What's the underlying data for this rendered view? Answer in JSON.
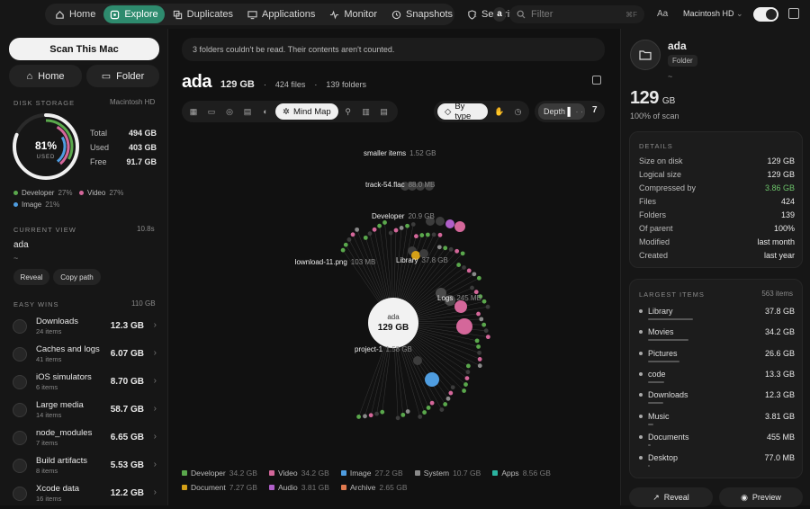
{
  "topbar": {
    "nav": [
      {
        "label": "Home",
        "icon": "home-icon"
      },
      {
        "label": "Explore",
        "icon": "compass-icon",
        "active": true
      },
      {
        "label": "Duplicates",
        "icon": "copy-icon"
      },
      {
        "label": "Applications",
        "icon": "monitor-icon"
      },
      {
        "label": "Monitor",
        "icon": "activity-icon"
      },
      {
        "label": "Snapshots",
        "icon": "clock-icon"
      },
      {
        "label": "Security",
        "icon": "shield-icon"
      }
    ],
    "avatar": "a",
    "filter_placeholder": "Filter",
    "filter_kbd": "⌘F",
    "text_size": "Aa",
    "volume": "Macintosh HD"
  },
  "sidebar": {
    "scan_label": "Scan This Mac",
    "home_label": "Home",
    "folder_label": "Folder",
    "disk_title": "DISK STORAGE",
    "disk_volume": "Macintosh HD",
    "used_pct": "81%",
    "used_word": "USED",
    "used_fraction": 0.81,
    "stats": [
      {
        "label": "Total",
        "value": "494 GB"
      },
      {
        "label": "Used",
        "value": "403 GB"
      },
      {
        "label": "Free",
        "value": "91.7 GB"
      }
    ],
    "legend": [
      {
        "label": "Developer",
        "pct": "27%",
        "color": "#5aa84c"
      },
      {
        "label": "Video",
        "pct": "27%",
        "color": "#d4679a"
      },
      {
        "label": "Image",
        "pct": "21%",
        "color": "#4f9de0"
      }
    ],
    "current_title": "CURRENT VIEW",
    "current_time": "10.8s",
    "current_name": "ada",
    "current_path": "~",
    "reveal_label": "Reveal",
    "copy_label": "Copy path",
    "wins_title": "EASY WINS",
    "wins_total": "110 GB",
    "wins": [
      {
        "title": "Downloads",
        "sub": "24 items",
        "size": "12.3 GB"
      },
      {
        "title": "Caches and logs",
        "sub": "41 items",
        "size": "6.07 GB"
      },
      {
        "title": "iOS simulators",
        "sub": "6 items",
        "size": "8.70 GB"
      },
      {
        "title": "Large media",
        "sub": "14 items",
        "size": "58.7 GB"
      },
      {
        "title": "node_modules",
        "sub": "7 items",
        "size": "6.65 GB"
      },
      {
        "title": "Build artifacts",
        "sub": "8 items",
        "size": "5.53 GB"
      },
      {
        "title": "Xcode data",
        "sub": "16 items",
        "size": "12.2 GB"
      }
    ]
  },
  "main": {
    "banner": "3 folders couldn't be read. Their contents aren't counted.",
    "name": "ada",
    "size": "129 GB",
    "files": "424 files",
    "folders": "139 folders",
    "sep": "·",
    "view_active": "Mind Map",
    "type_active": "By type",
    "depth_label": "Depth",
    "depth_value": "7",
    "center_name": "ada",
    "center_size": "129 GB",
    "map_labels": [
      {
        "name": "smaller items",
        "size": "1.52 GB"
      },
      {
        "name": "track-54.flac",
        "size": "88.0 MB"
      },
      {
        "name": "Developer",
        "size": "20.9 GB"
      },
      {
        "name": "download-11.png",
        "size": "103 MB"
      },
      {
        "name": "Library",
        "size": "37.8 GB"
      },
      {
        "name": "Logs",
        "size": "245 MB"
      },
      {
        "name": "project-1",
        "size": "1.58 GB"
      }
    ],
    "legend": [
      {
        "label": "Developer",
        "size": "34.2 GB",
        "color": "#5aa84c"
      },
      {
        "label": "Video",
        "size": "34.2 GB",
        "color": "#d4679a"
      },
      {
        "label": "Image",
        "size": "27.2 GB",
        "color": "#4f9de0"
      },
      {
        "label": "System",
        "size": "10.7 GB",
        "color": "#8a8a8a"
      },
      {
        "label": "Apps",
        "size": "8.56 GB",
        "color": "#2bb3a0"
      },
      {
        "label": "Document",
        "size": "7.27 GB",
        "color": "#d4a017"
      },
      {
        "label": "Audio",
        "size": "3.81 GB",
        "color": "#b05fc9"
      },
      {
        "label": "Archive",
        "size": "2.65 GB",
        "color": "#e07a4f"
      }
    ]
  },
  "details": {
    "name": "ada",
    "kind": "Folder",
    "path": "~",
    "size": "129",
    "unit": "GB",
    "pct_scan": "100% of scan",
    "title": "DETAILS",
    "rows": [
      {
        "k": "Size on disk",
        "v": "129 GB"
      },
      {
        "k": "Logical size",
        "v": "129 GB"
      },
      {
        "k": "Compressed by",
        "v": "3.86 GB",
        "green": true
      },
      {
        "k": "Files",
        "v": "424"
      },
      {
        "k": "Folders",
        "v": "139"
      },
      {
        "k": "Of parent",
        "v": "100%"
      },
      {
        "k": "Modified",
        "v": "last month"
      },
      {
        "k": "Created",
        "v": "last year"
      }
    ],
    "largest_title": "LARGEST ITEMS",
    "largest_count": "563 items",
    "largest": [
      {
        "n": "Library",
        "v": "37.8 GB",
        "f": 1.0
      },
      {
        "n": "Movies",
        "v": "34.2 GB",
        "f": 0.9
      },
      {
        "n": "Pictures",
        "v": "26.6 GB",
        "f": 0.7
      },
      {
        "n": "code",
        "v": "13.3 GB",
        "f": 0.35
      },
      {
        "n": "Downloads",
        "v": "12.3 GB",
        "f": 0.33
      },
      {
        "n": "Music",
        "v": "3.81 GB",
        "f": 0.12
      },
      {
        "n": "Documents",
        "v": "455 MB",
        "f": 0.05
      },
      {
        "n": "Desktop",
        "v": "77.0 MB",
        "f": 0.03
      }
    ],
    "reveal_label": "Reveal",
    "preview_label": "Preview"
  }
}
